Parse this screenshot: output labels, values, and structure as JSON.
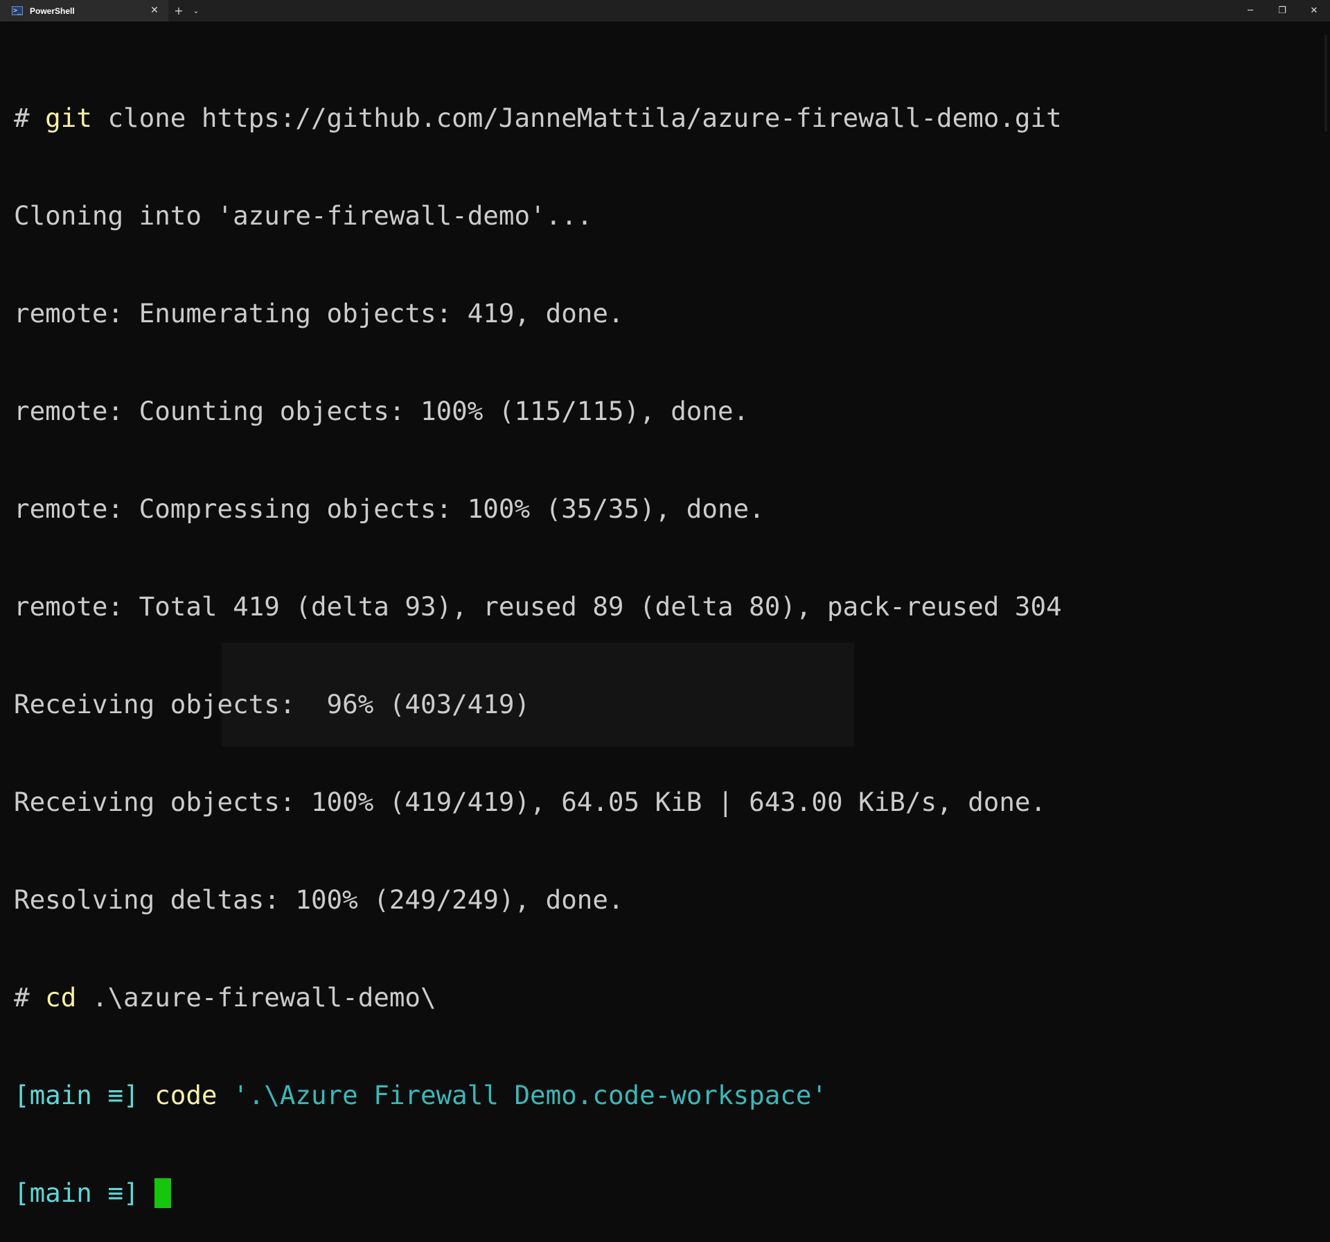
{
  "window": {
    "tab_title": "PowerShell",
    "tab_icon": "powershell-icon",
    "new_tab_label": "+",
    "dropdown_label": "⌄",
    "close_tab_label": "✕",
    "minimize_label": "─",
    "restore_label": "❐",
    "close_label": "✕"
  },
  "terminal": {
    "lines": [
      {
        "prompt": "# ",
        "command": "git",
        "args": " clone https://github.com/JanneMattila/azure-firewall-demo.git"
      },
      {
        "text": "Cloning into 'azure-firewall-demo'..."
      },
      {
        "text": "remote: Enumerating objects: 419, done."
      },
      {
        "text": "remote: Counting objects: 100% (115/115), done."
      },
      {
        "text": "remote: Compressing objects: 100% (35/35), done."
      },
      {
        "text": "remote: Total 419 (delta 93), reused 89 (delta 80), pack-reused 304"
      },
      {
        "text": "Receiving objects:  96% (403/419)"
      },
      {
        "text": "Receiving objects: 100% (419/419), 64.05 KiB | 643.00 KiB/s, done."
      },
      {
        "text": "Resolving deltas: 100% (249/249), done."
      },
      {
        "prompt": "# ",
        "command": "cd",
        "args": " .\\azure-firewall-demo\\"
      },
      {
        "branch_prompt": "[main ≡] ",
        "command": "code",
        "string_arg": " '.\\Azure Firewall Demo.code-workspace'"
      },
      {
        "branch_prompt": "[main ≡] "
      }
    ]
  },
  "colors": {
    "background": "#0c0c0c",
    "command": "#f9f1a5",
    "branch": "#61d6d6",
    "cursor": "#16c60c",
    "text": "#cccccc"
  }
}
